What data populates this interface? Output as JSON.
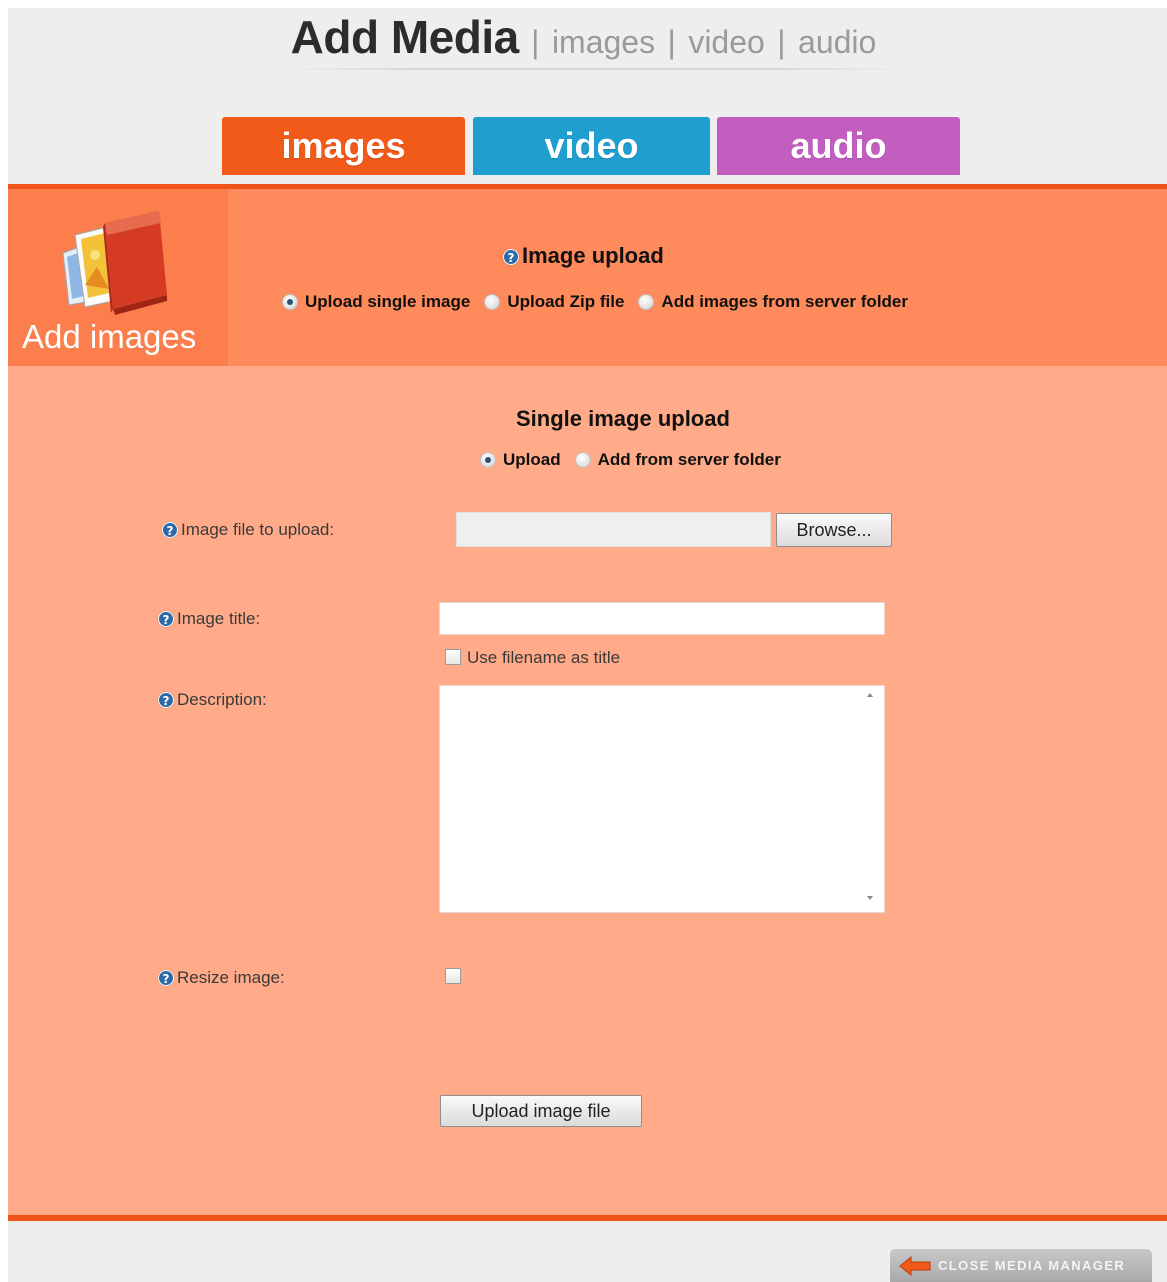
{
  "header": {
    "title": "Add Media",
    "separator": "|",
    "links": [
      "images",
      "video",
      "audio"
    ]
  },
  "tabs": [
    {
      "label": "images",
      "color": "#f25a1a"
    },
    {
      "label": "video",
      "color": "#1e9fcf"
    },
    {
      "label": "audio",
      "color": "#c25ec0"
    }
  ],
  "sidebar": {
    "icon": "photo-album-icon",
    "label": "Add images"
  },
  "image_upload": {
    "title": "Image upload",
    "mode_options": [
      "Upload single image",
      "Upload Zip file",
      "Add images from server folder"
    ],
    "selected_mode": "Upload single image"
  },
  "single_upload": {
    "title": "Single image upload",
    "source_options": [
      "Upload",
      "Add from server folder"
    ],
    "selected_source": "Upload"
  },
  "form": {
    "file_label": "Image file to upload:",
    "browse_label": "Browse...",
    "title_label": "Image title:",
    "title_value": "",
    "use_filename_label": "Use filename as title",
    "use_filename_checked": false,
    "description_label": "Description:",
    "description_value": "",
    "resize_label": "Resize image:",
    "resize_checked": false,
    "submit_label": "Upload image file"
  },
  "footer": {
    "close_label": "CLOSE MEDIA MANAGER"
  },
  "colors": {
    "accent_orange": "#f0541a",
    "panel_head": "#ff8a5b",
    "panel_body": "#ffaa88",
    "help_icon": "#2c6aa8"
  }
}
